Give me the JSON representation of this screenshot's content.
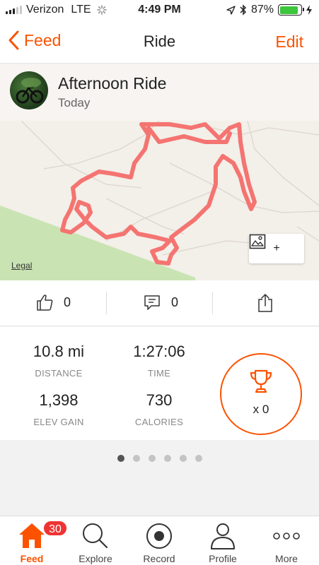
{
  "status_bar": {
    "carrier": "Verizon",
    "network": "LTE",
    "time": "4:49 PM",
    "battery": "87%",
    "battery_level": 0.87
  },
  "nav": {
    "back_label": "Feed",
    "title": "Ride",
    "edit_label": "Edit"
  },
  "activity": {
    "name": "Afternoon Ride",
    "date": "Today"
  },
  "map": {
    "legal_label": "Legal",
    "add_photo_label": "+"
  },
  "actions": {
    "kudos_count": "0",
    "comments_count": "0"
  },
  "stats": {
    "distance": {
      "value": "10.8 mi",
      "label": "DISTANCE"
    },
    "time": {
      "value": "1:27:06",
      "label": "TIME"
    },
    "elev_gain": {
      "value": "1,398",
      "label": "ELEV GAIN"
    },
    "calories": {
      "value": "730",
      "label": "CALORIES"
    },
    "achievements": "x 0"
  },
  "pager": {
    "page_count": 6,
    "active_index": 0
  },
  "tabs": [
    {
      "label": "Feed",
      "badge": "30",
      "icon": "home-icon"
    },
    {
      "label": "Explore",
      "icon": "search-icon"
    },
    {
      "label": "Record",
      "icon": "record-icon"
    },
    {
      "label": "Profile",
      "icon": "profile-icon"
    },
    {
      "label": "More",
      "icon": "more-icon"
    }
  ],
  "colors": {
    "accent": "#fc5200",
    "route": "#f47471",
    "badge": "#e33333",
    "battery": "#3cc63c"
  }
}
